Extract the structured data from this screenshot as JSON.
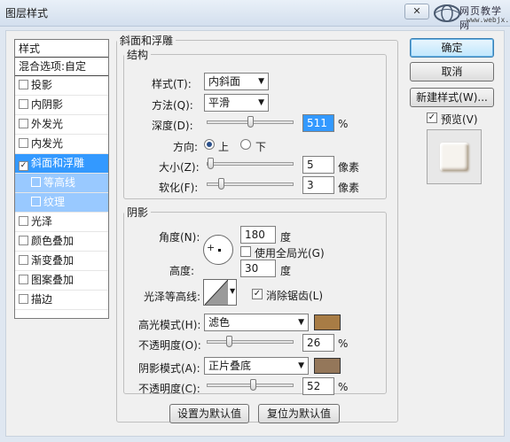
{
  "window": {
    "title": "图层样式",
    "close_glyph": "✕"
  },
  "watermark": {
    "site_cn": "网页教学网",
    "site_url": "www.webjx.com"
  },
  "style_list": {
    "header": "样式",
    "blend_options": "混合选项:自定",
    "items": [
      {
        "label": "投影",
        "checked": false
      },
      {
        "label": "内阴影",
        "checked": false
      },
      {
        "label": "外发光",
        "checked": false
      },
      {
        "label": "内发光",
        "checked": false
      },
      {
        "label": "斜面和浮雕",
        "checked": true
      },
      {
        "label": "等高线",
        "checked": false
      },
      {
        "label": "纹理",
        "checked": false
      },
      {
        "label": "光泽",
        "checked": false
      },
      {
        "label": "颜色叠加",
        "checked": false
      },
      {
        "label": "渐变叠加",
        "checked": false
      },
      {
        "label": "图案叠加",
        "checked": false
      },
      {
        "label": "描边",
        "checked": false
      }
    ],
    "check_glyph": "✓"
  },
  "bevel": {
    "legend": "斜面和浮雕",
    "structure": {
      "legend": "结构",
      "style_label": "样式(T):",
      "style_value": "内斜面",
      "technique_label": "方法(Q):",
      "technique_value": "平滑",
      "depth_label": "深度(D):",
      "depth_value": "511",
      "depth_unit": "%",
      "depth_level": 0.5,
      "direction_label": "方向:",
      "direction_up": "上",
      "direction_down": "下",
      "size_label": "大小(Z):",
      "size_value": "5",
      "size_unit": "像素",
      "soften_label": "软化(F):",
      "soften_value": "3",
      "soften_unit": "像素"
    },
    "shading": {
      "legend": "阴影",
      "angle_label": "角度(N):",
      "angle_value": "180",
      "angle_unit": "度",
      "global_light_label": "使用全局光(G)",
      "altitude_label": "高度:",
      "altitude_value": "30",
      "altitude_unit": "度",
      "gloss_contour_label": "光泽等高线:",
      "antialiased_label": "消除锯齿(L)",
      "highlight_mode_label": "高光模式(H):",
      "highlight_mode_value": "滤色",
      "highlight_color": "#a87c45",
      "highlight_opacity_label": "不透明度(O):",
      "highlight_opacity_value": "26",
      "highlight_opacity_level": 0.26,
      "shadow_mode_label": "阴影模式(A):",
      "shadow_mode_value": "正片叠底",
      "shadow_color": "#94775a",
      "shadow_opacity_label": "不透明度(C):",
      "shadow_opacity_value": "52",
      "shadow_opacity_level": 0.52,
      "percent_unit": "%"
    },
    "make_default": "设置为默认值",
    "reset_default": "复位为默认值"
  },
  "buttons": {
    "ok": "确定",
    "cancel": "取消",
    "new_style": "新建样式(W)...",
    "preview_label": "预览(V)"
  },
  "dropdown_glyph": "▼"
}
